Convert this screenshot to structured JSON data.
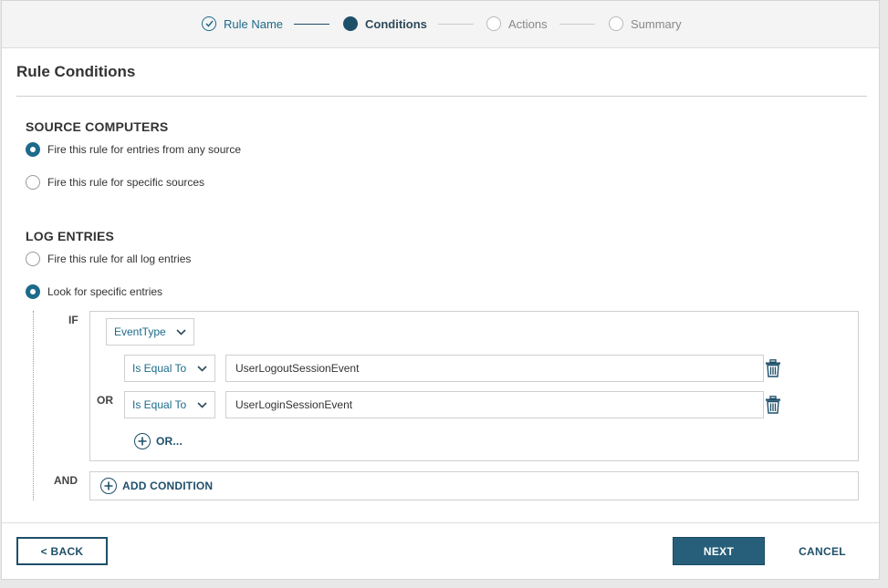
{
  "wizard": {
    "steps": [
      {
        "label": "Rule Name",
        "state": "done"
      },
      {
        "label": "Conditions",
        "state": "active"
      },
      {
        "label": "Actions",
        "state": "pending"
      },
      {
        "label": "Summary",
        "state": "pending"
      }
    ]
  },
  "page": {
    "title": "Rule Conditions"
  },
  "source_computers": {
    "title": "SOURCE COMPUTERS",
    "options": [
      {
        "label": "Fire this rule for entries from any source",
        "selected": true
      },
      {
        "label": "Fire this rule for specific sources",
        "selected": false
      }
    ]
  },
  "log_entries": {
    "title": "LOG ENTRIES",
    "options": [
      {
        "label": "Fire this rule for all log entries",
        "selected": false
      },
      {
        "label": "Look for specific entries",
        "selected": true
      }
    ]
  },
  "condition": {
    "if_label": "IF",
    "field": "EventType",
    "or_label": "OR",
    "rows": [
      {
        "operator": "Is Equal To",
        "value": "UserLogoutSessionEvent"
      },
      {
        "operator": "Is Equal To",
        "value": "UserLoginSessionEvent"
      }
    ],
    "add_or_label": "OR...",
    "and_label": "AND",
    "add_condition_label": "ADD CONDITION"
  },
  "footer": {
    "back_label": "< BACK",
    "next_label": "NEXT",
    "cancel_label": "CANCEL"
  },
  "colors": {
    "accent": "#1d6b8a",
    "accent_dark": "#1e4f69",
    "primary_button": "#275f7a"
  },
  "icons": [
    "check-circle-icon",
    "chevron-down-icon",
    "trash-icon",
    "plus-circle-icon"
  ]
}
